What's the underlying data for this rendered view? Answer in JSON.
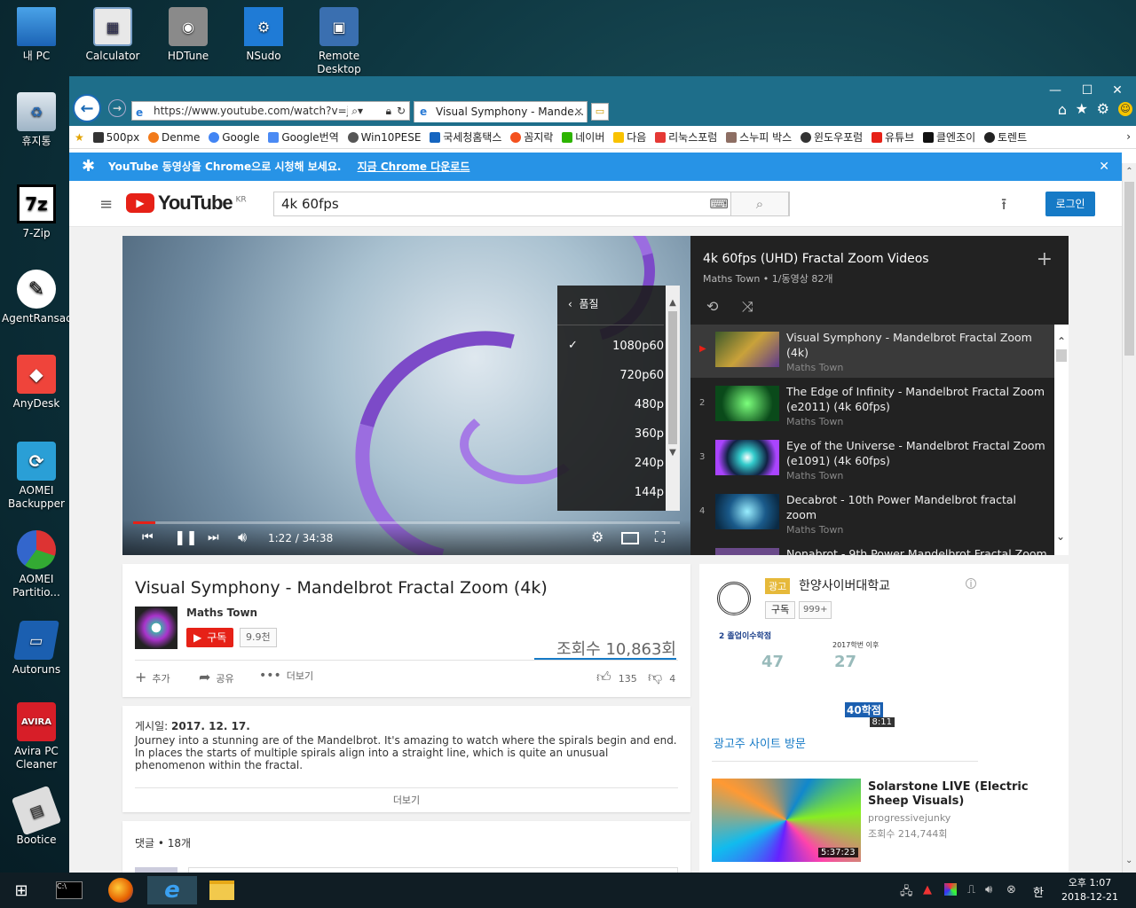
{
  "desktop": {
    "icons": [
      {
        "label": "내 PC"
      },
      {
        "label": "Calculator"
      },
      {
        "label": "HDTune"
      },
      {
        "label": "NSudo"
      },
      {
        "label": "Remote Desktop"
      },
      {
        "label": "휴지통"
      },
      {
        "label": "7-Zip"
      },
      {
        "label": "AgentRansack"
      },
      {
        "label": "AnyDesk"
      },
      {
        "label": "AOMEI Backupper"
      },
      {
        "label": "AOMEI Partitio..."
      },
      {
        "label": "Autoruns"
      },
      {
        "label": "Avira PC Cleaner"
      },
      {
        "label": "Bootice"
      }
    ]
  },
  "browser": {
    "address": "https://www.youtube.com/watch?v=jiIm",
    "tab_title": "Visual Symphony - Mande...",
    "favorites": [
      "500px",
      "Denme",
      "Google",
      "Google번역",
      "Win10PESE",
      "국세청홈택스",
      "꼼지락",
      "네이버",
      "다음",
      "리눅스포럼",
      "스누피 박스",
      "윈도우포럼",
      "유튜브",
      "클엔조이",
      "토렌트"
    ],
    "notice": {
      "text": "YouTube 동영상을 Chrome으로 시청해 보세요.",
      "link": "지금 Chrome 다운로드"
    }
  },
  "youtube": {
    "region": "KR",
    "search_value": "4k 60fps",
    "login": "로그인",
    "player": {
      "time": "1:22 / 34:38",
      "progress": 0.04,
      "quality_title": "품질",
      "quality_options": [
        "1080p60",
        "720p60",
        "480p",
        "360p",
        "240p",
        "144p"
      ],
      "quality_selected": "1080p60"
    },
    "playlist": {
      "title": "4k 60fps (UHD) Fractal Zoom Videos",
      "meta": "Maths Town • 1/동영상 82개",
      "items": [
        {
          "num": "▶",
          "title": "Visual Symphony - Mandelbrot Fractal Zoom (4k)",
          "channel": "Maths Town"
        },
        {
          "num": "2",
          "title": "The Edge of Infinity - Mandelbrot Fractal Zoom (e2011) (4k 60fps)",
          "channel": "Maths Town"
        },
        {
          "num": "3",
          "title": "Eye of the Universe - Mandelbrot Fractal Zoom (e1091) (4k 60fps)",
          "channel": "Maths Town"
        },
        {
          "num": "4",
          "title": "Decabrot - 10th Power Mandelbrot fractal zoom",
          "channel": "Maths Town"
        },
        {
          "num": "",
          "title": "Nonabrot - 9th Power Mandelbrot Fractal Zoom",
          "channel": ""
        }
      ]
    },
    "video": {
      "title": "Visual Symphony - Mandelbrot Fractal Zoom (4k)",
      "channel": "Maths Town",
      "subscribe": "구독",
      "sub_count": "9.9천",
      "views": "조회수 10,863회",
      "add": "추가",
      "share": "공유",
      "more": "더보기",
      "likes": "135",
      "dislikes": "4"
    },
    "description": {
      "date_label": "게시일:",
      "date": "2017. 12. 17.",
      "text": "Journey into a stunning are of the Mandelbrot. It's amazing to watch where the spirals begin and end. In places the starts of multiple spirals align into a straight line, which is quite an unusual phenomenon within the fractal.",
      "more": "더보기"
    },
    "comments": "댓글 • 18개",
    "ad": {
      "badge": "광고",
      "name": "한양사이버대학교",
      "subscribe": "구독",
      "sub_count": "999+",
      "visit": "광고주 사이트 방문",
      "duration": "8:11",
      "banner_text": [
        "2 졸업이수학점",
        "47",
        "27",
        "2017학번 이후",
        "40학점"
      ]
    },
    "related": [
      {
        "title": "Solarstone LIVE (Electric Sheep Visuals)",
        "channel": "progressivejunky",
        "views": "조회수 214,744회",
        "duration": "5:37:23"
      }
    ]
  },
  "taskbar": {
    "time": "오후 1:07",
    "date": "2018-12-21",
    "ime": "한"
  },
  "colors": {
    "accent": "#2793e6",
    "youtube_red": "#e62117",
    "titlebar": "#1e6e8a"
  }
}
